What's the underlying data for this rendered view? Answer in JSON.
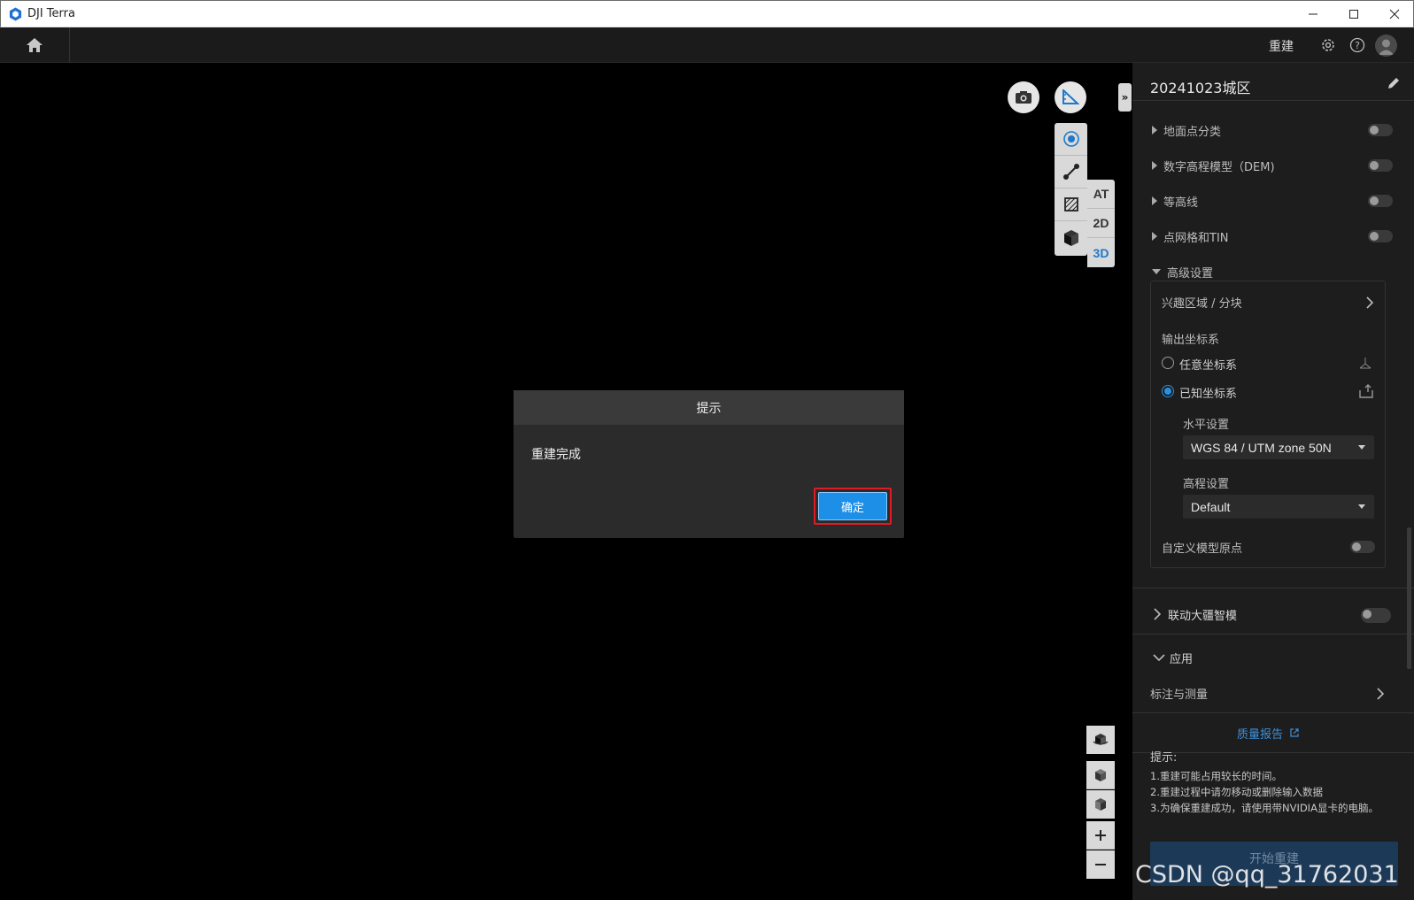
{
  "window": {
    "title": "DJI Terra"
  },
  "toolbar": {
    "rebuild_label": "重建"
  },
  "viewport": {
    "view_modes": [
      "AT",
      "2D",
      "3D"
    ],
    "active_mode": "3D"
  },
  "panel": {
    "project_title": "20241023城区",
    "sections": [
      {
        "label": "地面点分类",
        "expanded": false,
        "enabled": false
      },
      {
        "label": "数字高程模型（DEM)",
        "expanded": false,
        "enabled": false
      },
      {
        "label": "等高线",
        "expanded": false,
        "enabled": false
      },
      {
        "label": "点网格和TIN",
        "expanded": false,
        "enabled": false
      }
    ],
    "advanced": {
      "label": "高级设置",
      "roi_label": "兴趣区域 / 分块",
      "output_crs_label": "输出坐标系",
      "arbitrary_crs_label": "任意坐标系",
      "known_crs_label": "已知坐标系",
      "selected_crs": "已知坐标系",
      "horizontal_label": "水平设置",
      "horizontal_value": "WGS 84 / UTM zone 50N",
      "vertical_label": "高程设置",
      "vertical_value": "Default",
      "custom_origin_label": "自定义模型原点",
      "custom_origin_enabled": false
    },
    "linkage": {
      "label": "联动大疆智模",
      "enabled": false
    },
    "apply": {
      "label": "应用",
      "annotate_label": "标注与测量"
    },
    "quality_report_label": "质量报告",
    "tips": {
      "heading": "提示:",
      "lines": [
        "1.重建可能占用较长的时间。",
        "2.重建过程中请勿移动或删除输入数据",
        "3.为确保重建成功，请使用带NVIDIA显卡的电脑。"
      ]
    },
    "start_button_label": "开始重建"
  },
  "dialog": {
    "title": "提示",
    "message": "重建完成",
    "ok_label": "确定"
  },
  "watermark": "CSDN @qq_31762031",
  "colors": {
    "accent": "#1e8fe6",
    "highlight_outline": "#e01b24",
    "panel_bg": "#1d1d1d"
  }
}
